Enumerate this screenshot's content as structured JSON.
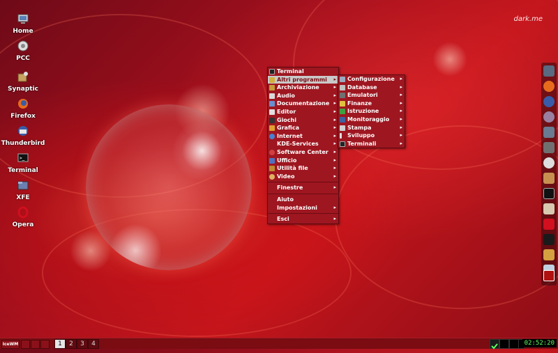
{
  "brand_text": "dark.me",
  "desktop_icons": [
    {
      "label": "Home",
      "icon": "home-icon"
    },
    {
      "label": "PCC",
      "icon": "pcc-icon"
    },
    {
      "label": "Synaptic",
      "icon": "synaptic-icon"
    },
    {
      "label": "Firefox",
      "icon": "firefox-icon"
    },
    {
      "label": "Thunderbird",
      "icon": "thunderbird-icon"
    },
    {
      "label": "Terminal",
      "icon": "terminal-icon"
    },
    {
      "label": "XFE",
      "icon": "xfe-icon"
    },
    {
      "label": "Opera",
      "icon": "opera-icon"
    }
  ],
  "main_menu": {
    "items": [
      {
        "label": "Terminal",
        "has_submenu": false
      },
      {
        "label": "Altri programmi",
        "has_submenu": true
      },
      {
        "label": "Archiviazione",
        "has_submenu": true
      },
      {
        "label": "Audio",
        "has_submenu": true
      },
      {
        "label": "Documentazione",
        "has_submenu": true
      },
      {
        "label": "Editor",
        "has_submenu": true
      },
      {
        "label": "Giochi",
        "has_submenu": true
      },
      {
        "label": "Grafica",
        "has_submenu": true
      },
      {
        "label": "Internet",
        "has_submenu": true
      },
      {
        "label": "KDE-Services",
        "has_submenu": true
      },
      {
        "label": "Software Center",
        "has_submenu": true
      },
      {
        "label": "Ufficio",
        "has_submenu": true
      },
      {
        "label": "Utilità file",
        "has_submenu": true
      },
      {
        "label": "Video",
        "has_submenu": true
      },
      {
        "label": "Finestre",
        "has_submenu": true
      },
      {
        "label": "Aiuto",
        "has_submenu": false
      },
      {
        "label": "Impostazioni",
        "has_submenu": true
      },
      {
        "label": "Esci",
        "has_submenu": true
      }
    ]
  },
  "sub_menu": {
    "items": [
      {
        "label": "Configurazione"
      },
      {
        "label": "Database"
      },
      {
        "label": "Emulatori"
      },
      {
        "label": "Finanze"
      },
      {
        "label": "Istruzione"
      },
      {
        "label": "Monitoraggio"
      },
      {
        "label": "Stampa"
      },
      {
        "label": "Sviluppo"
      },
      {
        "label": "Terminali"
      }
    ]
  },
  "arrow_glyph": "▸",
  "taskbar": {
    "start_label": "IceWM",
    "workspaces": [
      "1",
      "2",
      "3",
      "4"
    ],
    "active_workspace": "1",
    "clock": "02:52:20"
  },
  "colors": {
    "menu_bg": "#9e1620",
    "menu_active": "#c9c9c9",
    "taskbar_bg": "#7a0c12"
  }
}
